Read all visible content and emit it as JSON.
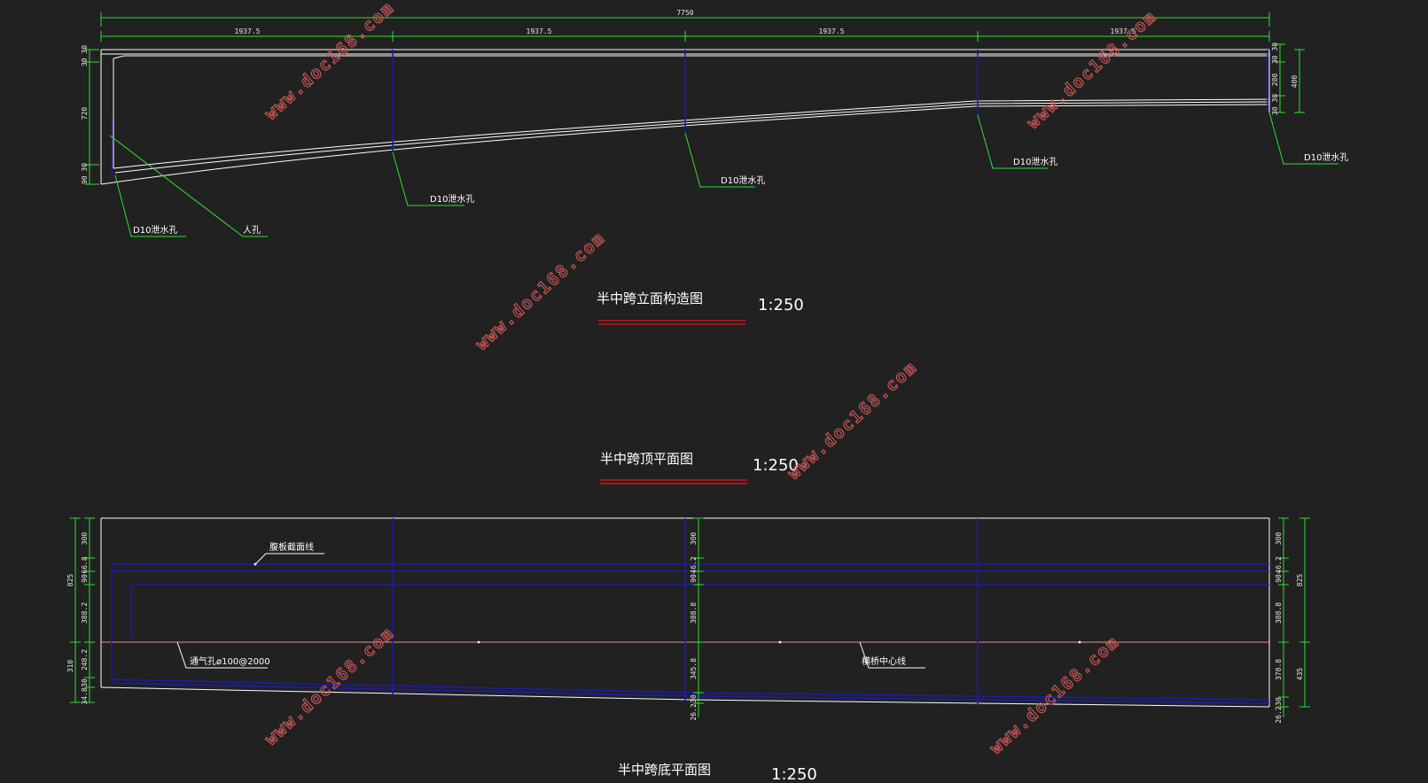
{
  "colors": {
    "background": "#212121",
    "outline": "#ffffff",
    "dimension": "#2fe02f",
    "rebar": "#1c1ca8",
    "centerline": "#e89090",
    "underline": "#c8151b",
    "watermark": "#cf5858"
  },
  "elevation": {
    "overall_dim": "7750",
    "segment_dims": [
      "1937.5",
      "1937.5",
      "1937.5",
      "1937.5"
    ],
    "left_dims": [
      "30 30",
      "720",
      "90 30"
    ],
    "right_dims": [
      "30 30",
      "280",
      "30 30",
      "400"
    ],
    "callouts": {
      "drain_left": "D10泄水孔",
      "manhole": "人孔",
      "drain_1": "D10泄水孔",
      "drain_2": "D10泄水孔",
      "drain_3": "D10泄水孔",
      "drain_right": "D10泄水孔"
    },
    "title": "半中跨立面构造图",
    "scale": "1:250"
  },
  "top_plan": {
    "title": "半中跨顶平面图",
    "scale": "1:250"
  },
  "bottom_plan": {
    "left_dims": [
      "825",
      "300",
      "66.8",
      "90",
      "388.2",
      "310",
      "248.2",
      "30",
      "34.8"
    ],
    "mid_dims": [
      "300",
      "46.2",
      "90",
      "388.8",
      "345.8",
      "30",
      "26.2"
    ],
    "right_dims": [
      "300",
      "46.2",
      "90",
      "388.8",
      "378.8",
      "30",
      "26.2",
      "825",
      "435"
    ],
    "callouts": {
      "edge": "腹板截面线",
      "vent": "通气孔ø100@2000",
      "center": "横桥中心线"
    },
    "title": "半中跨底平面图",
    "scale": "1:250"
  },
  "watermarks": [
    "www.doc168.com",
    "www.doc168.com",
    "www.doc168.com",
    "www.doc168.com",
    "www.doc168.com",
    "www.doc168.com"
  ]
}
